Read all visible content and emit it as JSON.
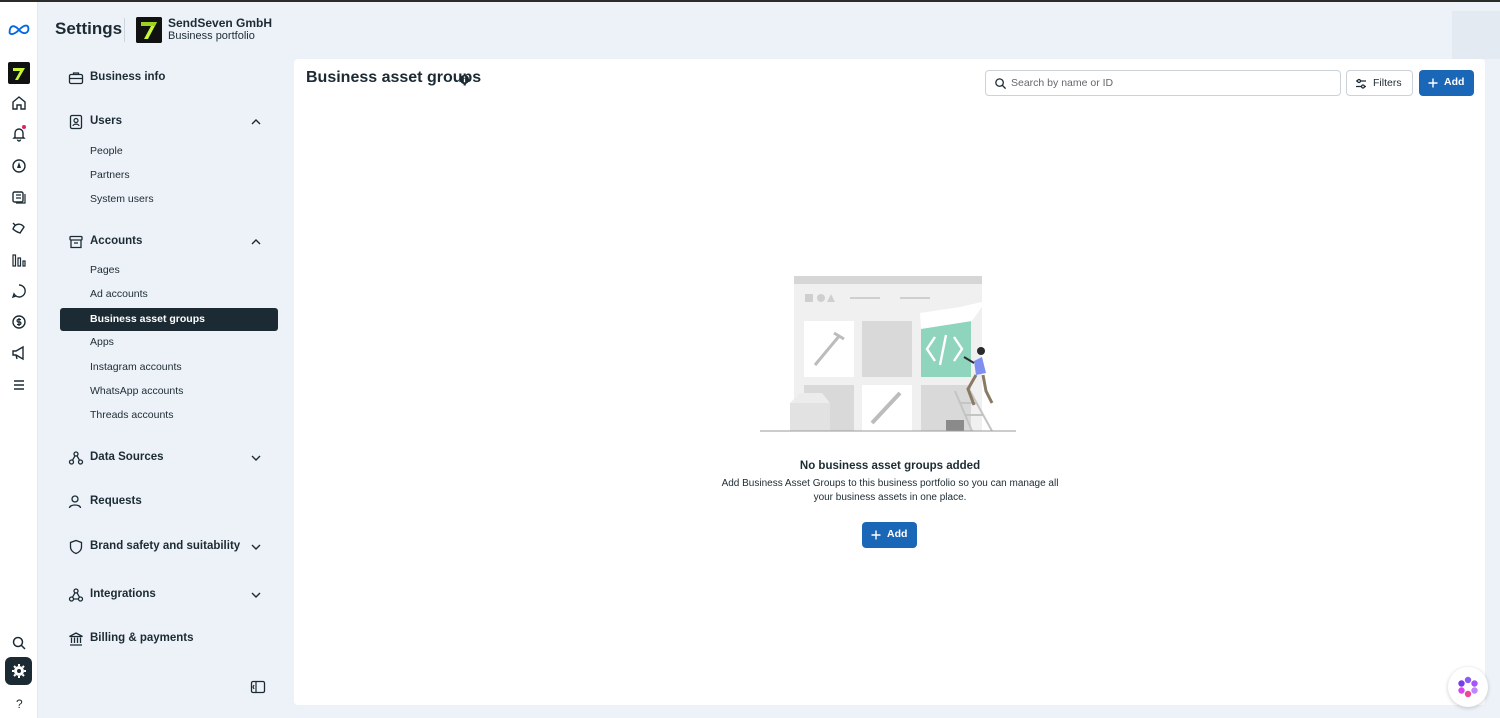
{
  "header": {
    "title": "Settings",
    "business_name": "SendSeven GmbH",
    "business_sub": "Business portfolio"
  },
  "rail": {
    "icons": [
      "meta-logo-icon",
      "business-avatar",
      "home-icon",
      "bell-icon",
      "compass-icon",
      "pages-icon",
      "tag-icon",
      "insights-icon",
      "chat-icon",
      "billing-icon",
      "megaphone-icon",
      "menu-icon",
      "search-icon",
      "settings-icon",
      "help-icon"
    ]
  },
  "nav": {
    "business_info": "Business info",
    "users": "Users",
    "users_items": [
      "People",
      "Partners",
      "System users"
    ],
    "accounts": "Accounts",
    "accounts_items": [
      "Pages",
      "Ad accounts",
      "Business asset groups",
      "Apps",
      "Instagram accounts",
      "WhatsApp accounts",
      "Threads accounts"
    ],
    "selected": "Business asset groups",
    "data_sources": "Data Sources",
    "requests": "Requests",
    "brand_safety": "Brand safety and suitability",
    "integrations": "Integrations",
    "billing": "Billing & payments"
  },
  "main": {
    "title": "Business asset groups",
    "search_placeholder": "Search by name or ID",
    "filters_label": "Filters",
    "add_label": "Add",
    "empty_title": "No business asset groups added",
    "empty_desc": "Add Business Asset Groups to this business portfolio so you can manage all your business assets in one place.",
    "empty_add_label": "Add"
  },
  "colors": {
    "accent": "#1b67b7",
    "selected_bg": "#1c2b33",
    "page_bg": "#edf2f9",
    "brand_logo_green": "#c6f53a"
  }
}
